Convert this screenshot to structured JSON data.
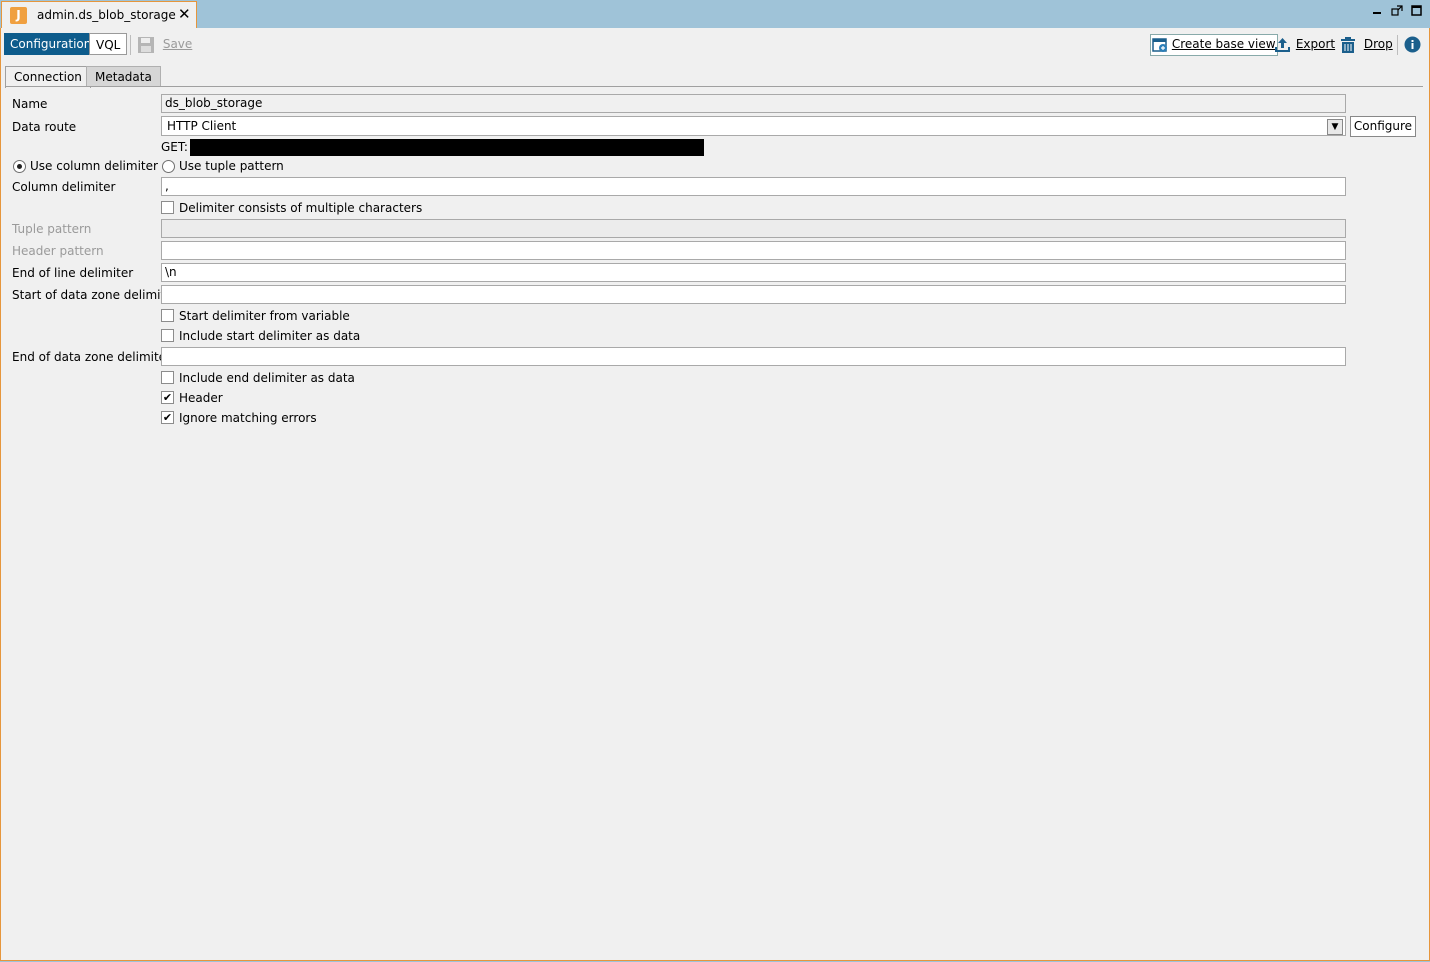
{
  "window": {
    "tab_title": "admin.ds_blob_storage",
    "app_icon_glyph": "J",
    "close_glyph": "✕"
  },
  "toolbar": {
    "configuration_label": "Configuration",
    "vql_label": "VQL",
    "save_label": "Save",
    "create_base_view_label": "Create base view",
    "export_label": "Export",
    "drop_label": "Drop"
  },
  "tabs": {
    "connection": "Connection",
    "metadata": "Metadata"
  },
  "form": {
    "name_label": "Name",
    "name_value": "ds_blob_storage",
    "data_route_label": "Data route",
    "data_route_value": "HTTP Client",
    "configure_label": "Configure",
    "get_label": "GET:",
    "use_column_delimiter_label": "Use column delimiter",
    "use_tuple_pattern_label": "Use tuple pattern",
    "column_delimiter_label": "Column delimiter",
    "column_delimiter_value": ",",
    "multi_char_label": "Delimiter consists of multiple characters",
    "tuple_pattern_label": "Tuple pattern",
    "header_pattern_label": "Header pattern",
    "end_of_line_label": "End of line delimiter",
    "end_of_line_value": "\\n",
    "start_zone_label": "Start of data zone delimiter",
    "start_from_variable_label": "Start delimiter from variable",
    "include_start_label": "Include start delimiter as data",
    "end_zone_label": "End of data zone delimiter",
    "include_end_label": "Include end delimiter as data",
    "header_label": "Header",
    "ignore_errors_label": "Ignore matching errors"
  },
  "colors": {
    "accent": "#0e5c8c",
    "tab_border": "#e6963c",
    "title_bar": "#9fc3d8"
  },
  "icons": [
    "app-icon",
    "close-icon",
    "minimize-icon",
    "restore-icon",
    "maximize-icon",
    "save-icon",
    "create-base-view-icon",
    "export-icon",
    "drop-icon",
    "info-icon"
  ]
}
